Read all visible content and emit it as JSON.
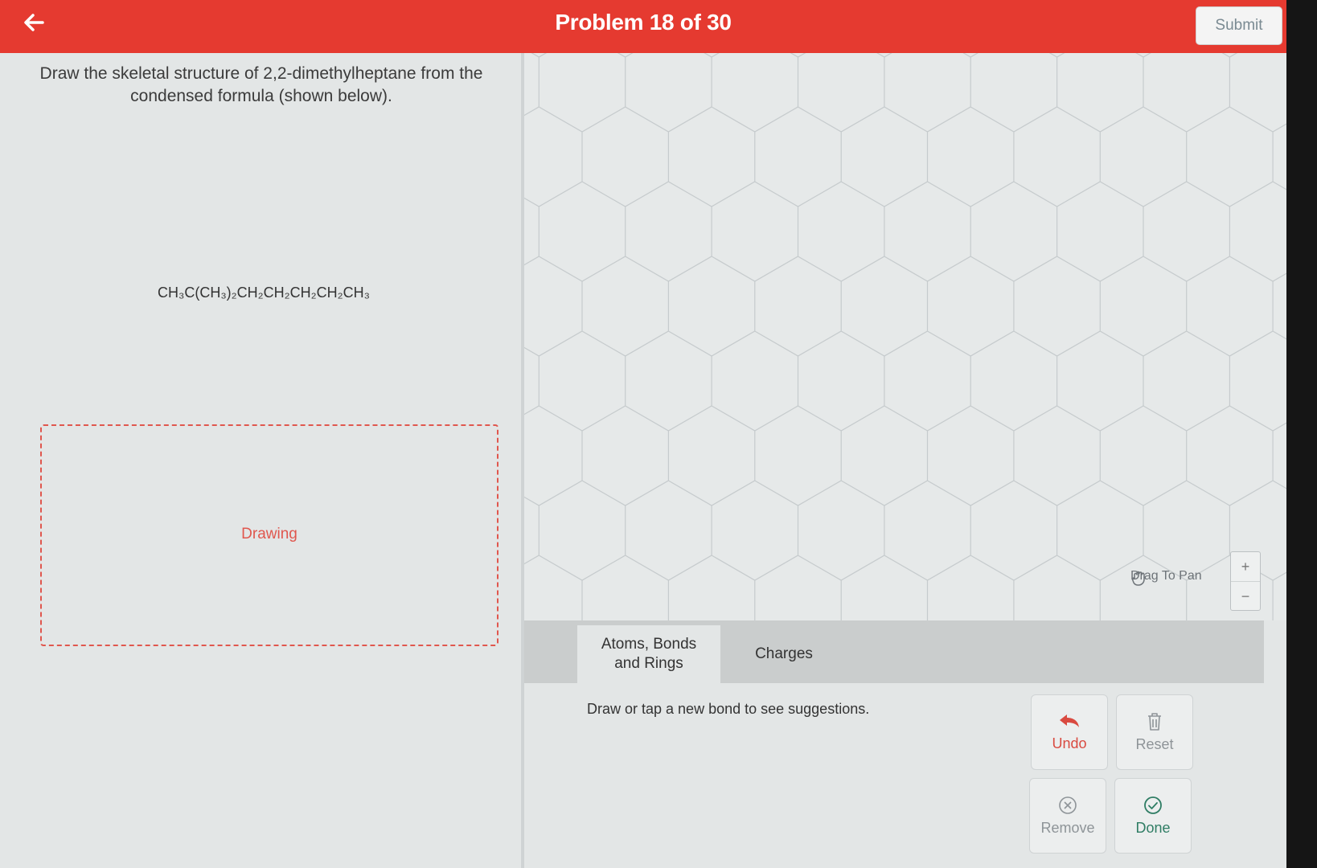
{
  "header": {
    "title": "Problem 18 of 30",
    "submit_label": "Submit"
  },
  "question": {
    "prompt": "Draw the skeletal structure of 2,2-dimethylheptane from the condensed formula (shown below).",
    "formula": "CH₃C(CH₃)₂CH₂CH₂CH₂CH₂CH₃",
    "drawing_label": "Drawing"
  },
  "canvas": {
    "drag_to_pan": "Drag To Pan",
    "zoom_in": "+",
    "zoom_out": "−"
  },
  "tabs": [
    {
      "label": "Atoms, Bonds and Rings",
      "active": true
    },
    {
      "label": "Charges",
      "active": false
    }
  ],
  "panel": {
    "hint": "Draw or tap a new bond to see suggestions.",
    "undo_label": "Undo",
    "reset_label": "Reset",
    "remove_label": "Remove",
    "done_label": "Done"
  },
  "colors": {
    "brand_red": "#e53a30",
    "undo_red": "#d94a40",
    "done_green": "#2f7d64"
  },
  "icons": [
    "arrow-left-icon",
    "hand-icon",
    "undo-icon",
    "trash-icon",
    "remove-circle-icon",
    "check-circle-icon"
  ]
}
